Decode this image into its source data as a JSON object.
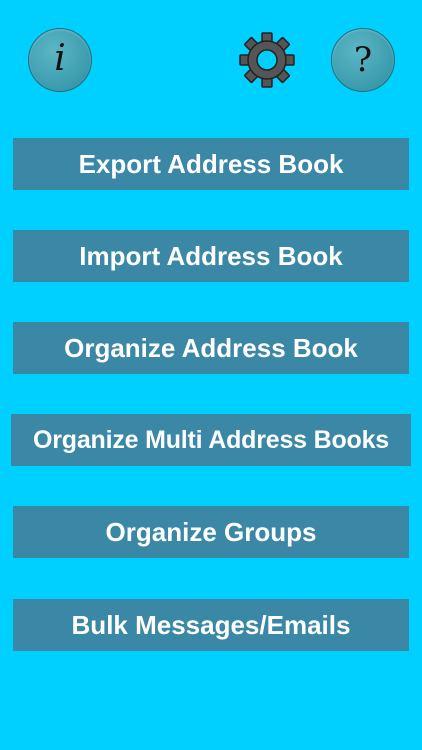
{
  "header": {
    "info_icon": "info-icon",
    "info_glyph": "i",
    "settings_icon": "gear-icon",
    "help_icon": "help-icon",
    "help_glyph": "?"
  },
  "menu": {
    "items": [
      {
        "label": "Export Address Book"
      },
      {
        "label": "Import Address Book"
      },
      {
        "label": "Organize Address Book"
      },
      {
        "label": "Organize Multi Address Books"
      },
      {
        "label": "Organize Groups"
      },
      {
        "label": "Bulk Messages/Emails"
      }
    ]
  },
  "colors": {
    "background": "#00d0ff",
    "button": "#3a87a6",
    "button_text": "#ffffff",
    "round_button": "#3f9fb0"
  }
}
